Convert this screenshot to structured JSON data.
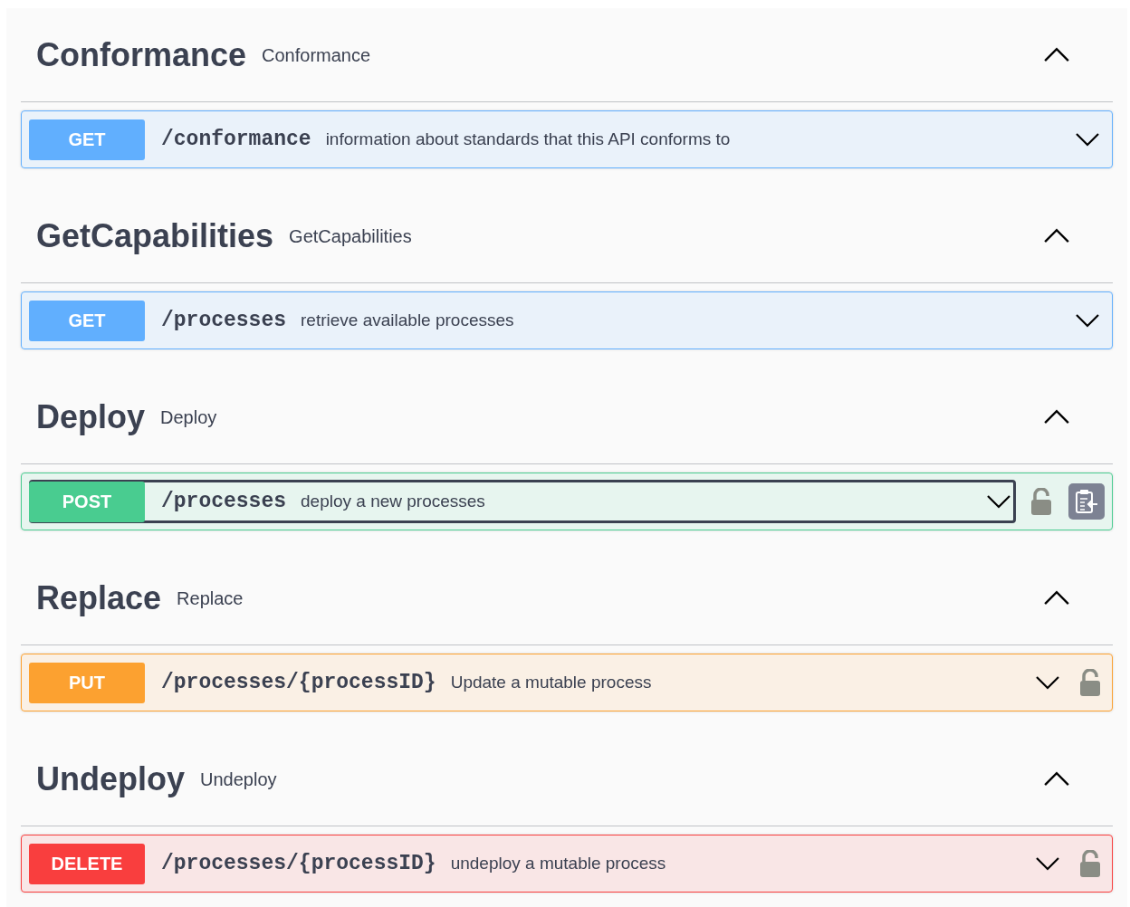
{
  "sections": [
    {
      "name": "Conformance",
      "description": "Conformance",
      "expanded": true,
      "operations": [
        {
          "method": "GET",
          "color": "#61affe",
          "path": "/conformance",
          "summary": "information about standards that this API conforms to",
          "expanded": false,
          "focused": false,
          "locked": false,
          "copy_button": false
        }
      ]
    },
    {
      "name": "GetCapabilities",
      "description": "GetCapabilities",
      "expanded": true,
      "operations": [
        {
          "method": "GET",
          "color": "#61affe",
          "path": "/processes",
          "summary": "retrieve available processes",
          "expanded": false,
          "focused": false,
          "locked": false,
          "copy_button": false
        }
      ]
    },
    {
      "name": "Deploy",
      "description": "Deploy",
      "expanded": true,
      "operations": [
        {
          "method": "POST",
          "color": "#49cc90",
          "path": "/processes",
          "summary": "deploy a new processes",
          "expanded": false,
          "focused": true,
          "locked": true,
          "copy_button": true
        }
      ]
    },
    {
      "name": "Replace",
      "description": "Replace",
      "expanded": true,
      "operations": [
        {
          "method": "PUT",
          "color": "#fca130",
          "path": "/processes/{processID}",
          "summary": "Update a mutable process",
          "expanded": false,
          "focused": false,
          "locked": true,
          "copy_button": false
        }
      ]
    },
    {
      "name": "Undeploy",
      "description": "Undeploy",
      "expanded": true,
      "operations": [
        {
          "method": "DELETE",
          "color": "#f93e3e",
          "path": "/processes/{processID}",
          "summary": "undeploy a mutable process",
          "expanded": false,
          "focused": false,
          "locked": true,
          "copy_button": false
        }
      ]
    }
  ]
}
